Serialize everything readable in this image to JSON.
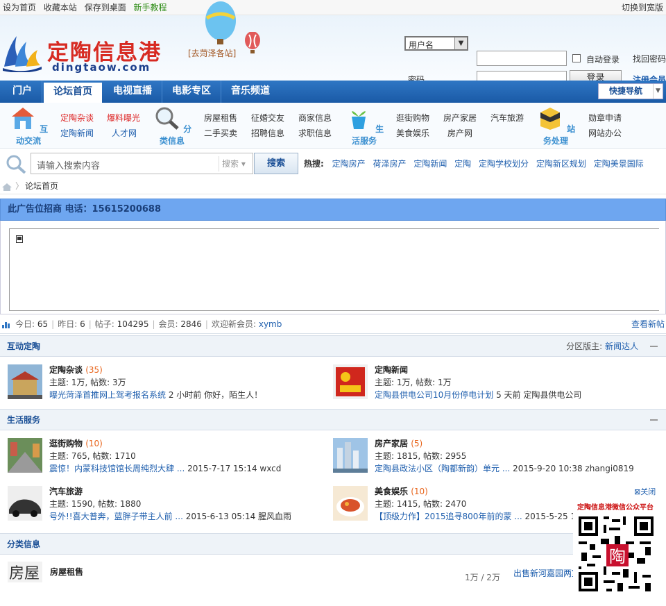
{
  "topbar": {
    "links": [
      "设为首页",
      "收藏本站",
      "保存到桌面"
    ],
    "tutorial": "新手教程",
    "switch_wide": "切换到宽版"
  },
  "header": {
    "site_name": "定陶信息港",
    "domain": "dingtaow.com",
    "sub_station": "[去菏泽各站]"
  },
  "login": {
    "username_select": "用户名",
    "password_label": "密码",
    "auto_login": "自动登录",
    "find_password": "找回密码",
    "login_button": "登录",
    "register": "注册会员"
  },
  "nav": {
    "tabs": [
      "门户",
      "论坛首页",
      "电视直播",
      "电影专区",
      "音乐频道"
    ],
    "active": "论坛首页",
    "quick_nav": "快捷导航"
  },
  "categories": {
    "interact": {
      "label": "互动交流",
      "links": [
        "定陶杂谈",
        "爆料曝光",
        "定陶新闻",
        "人才网"
      ]
    },
    "classified": {
      "label": "分类信息",
      "links": [
        "房屋租售",
        "征婚交友",
        "商家信息",
        "二手买卖",
        "招聘信息",
        "求职信息"
      ]
    },
    "life": {
      "label": "生活服务",
      "links": [
        "逛街购物",
        "房产家居",
        "汽车旅游",
        "美食娱乐",
        "房产网"
      ]
    },
    "affairs": {
      "label": "站务处理",
      "links": [
        "勋章申请",
        "网站办公"
      ]
    }
  },
  "search": {
    "placeholder": "请输入搜索内容",
    "type": "搜索",
    "button": "搜索",
    "hot_label": "热搜:",
    "hot": [
      "定陶房产",
      "荷泽房产",
      "定陶新闻",
      "定陶",
      "定陶学校划分",
      "定陶新区规划",
      "定陶美景国际"
    ]
  },
  "breadcrumb": {
    "current": "论坛首页"
  },
  "ad": {
    "text": "此广告位招商 电话：15615200688"
  },
  "stats": {
    "today_label": "今日:",
    "today": "65",
    "yesterday_label": "昨日:",
    "yesterday": "6",
    "posts_label": "帖子:",
    "posts": "104295",
    "members_label": "会员:",
    "members": "2846",
    "welcome_label": "欢迎新会员:",
    "welcome": "xymb",
    "newest": "查看新帖"
  },
  "sections": [
    {
      "title": "互动定陶",
      "moderator_label": "分区版主:",
      "moderator": "新闻达人",
      "forums": [
        {
          "name": "定陶杂谈",
          "count": "(35)",
          "stat": "主题: 1万, 帖数: 3万",
          "last_title": "曝光菏泽首推网上驾考报名系统",
          "last_meta": "2 小时前 你好，陌生人！"
        },
        {
          "name": "定陶新闻",
          "count": "",
          "stat": "主题: 1万, 帖数: 1万",
          "last_title": "定陶县供电公司10月份停电计划",
          "last_meta": "5 天前 定陶县供电公司"
        }
      ]
    },
    {
      "title": "生活服务",
      "forums": [
        {
          "name": "逛街购物",
          "count": "(10)",
          "stat": "主题: 765, 帖数: 1710",
          "last_title": "震惊！内蒙科技馆馆长周纯烈大肆 ...",
          "last_meta": "2015-7-17 15:14 wxcd"
        },
        {
          "name": "房产家居",
          "count": "(5)",
          "stat": "主题: 1815, 帖数: 2955",
          "last_title": "定陶县政法小区（陶都新韵）单元 ...",
          "last_meta": "2015-9-20 10:38 zhangi0819"
        },
        {
          "name": "汽车旅游",
          "count": "",
          "stat": "主题: 1590, 帖数: 1880",
          "last_title": "号外!!喜大普奔，蓝胖子带主人前 ...",
          "last_meta": "2015-6-13 05:14 腥风血雨"
        },
        {
          "name": "美食娱乐",
          "count": "(10)",
          "stat": "主题: 1415, 帖数: 2470",
          "last_title": "【顶级力作】2015追寻800年前的蒙 ...",
          "last_meta": "2015-5-25 1"
        }
      ]
    },
    {
      "title": "分类信息",
      "forums": [
        {
          "name": "房屋租售",
          "stat": "1万 / 2万",
          "last_title": "出售新河嘉园两室一厅精装修房"
        }
      ]
    }
  ],
  "qr": {
    "close": "关闭",
    "title": "定陶信息港微信公众平台",
    "stamp": "陶"
  },
  "colors": {
    "nav": "#1f64b2",
    "ad_bar": "#6ea6f0",
    "brand_red": "#d72a22"
  }
}
